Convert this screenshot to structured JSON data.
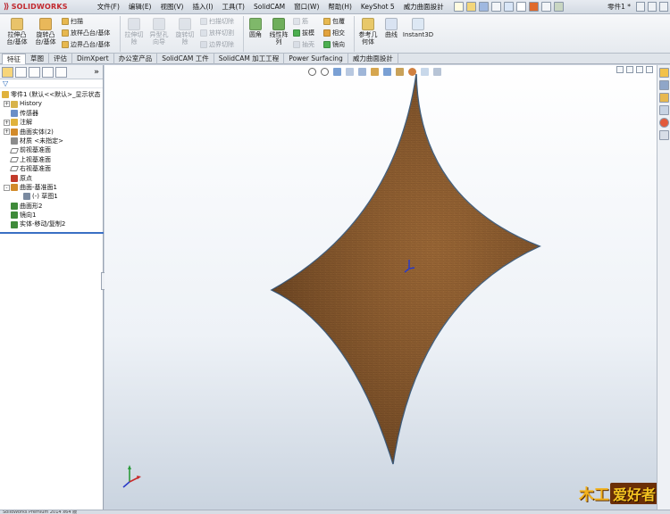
{
  "app": {
    "logo": "SOLIDWORKS",
    "doc_title": "零件1 *"
  },
  "menu": [
    "文件(F)",
    "编辑(E)",
    "视图(V)",
    "插入(I)",
    "工具(T)",
    "SolidCAM",
    "窗口(W)",
    "帮助(H)",
    "KeyShot 5",
    "威力曲面設計"
  ],
  "ribbon": {
    "extrude": "拉伸凸台/基体",
    "revolve": "旋转凸台/基体",
    "sweep": "扫描",
    "loft": "放样凸台/基体",
    "boundary": "边界凸台/基体",
    "extrude_cut": "拉伸切除",
    "hole_wizard": "异型孔向导",
    "revolve_cut": "旋转切除",
    "sweep_cut": "扫描切除",
    "loft_cut": "放样切割",
    "boundary_cut": "边界切除",
    "fillet": "圆角",
    "linear_pattern": "线性阵列",
    "rib": "筋",
    "draft": "拔模",
    "shell": "抽壳",
    "wrap": "包覆",
    "intersect": "相交",
    "mirror": "镜向",
    "ref_geometry": "参考几何体",
    "curves": "曲线",
    "instant3d": "Instant3D"
  },
  "tabs": [
    "特征",
    "草图",
    "评估",
    "DimXpert",
    "办公室产品",
    "SolidCAM 工件",
    "SolidCAM 加工工程",
    "Power Surfacing",
    "威力曲面設計"
  ],
  "tree": {
    "root": "零件1 (默认<<默认>_显示状态",
    "items": [
      {
        "label": "History",
        "pm": "+",
        "color": "#d8b34a"
      },
      {
        "label": "传感器",
        "pm": "",
        "color": "#6b8fc7"
      },
      {
        "label": "注解",
        "pm": "+",
        "color": "#e0b23c"
      },
      {
        "label": "曲面实体(2)",
        "pm": "+",
        "color": "#d28a2a"
      },
      {
        "label": "材质 <未指定>",
        "pm": "",
        "color": "#8c8c8c"
      },
      {
        "label": "前视基准面",
        "pm": "",
        "color": "plane"
      },
      {
        "label": "上视基准面",
        "pm": "",
        "color": "plane"
      },
      {
        "label": "右视基准面",
        "pm": "",
        "color": "plane"
      },
      {
        "label": "原点",
        "pm": "",
        "color": "#c23a2a"
      },
      {
        "label": "曲面-基准面1",
        "pm": "-",
        "color": "#d28a2a"
      },
      {
        "label": "(-) 草图1",
        "pm": "",
        "color": "#7a8aa0",
        "indent": 1
      },
      {
        "label": "曲面形2",
        "pm": "",
        "color": "#3f8a3a"
      },
      {
        "label": "镜向1",
        "pm": "",
        "color": "#3f8a3a"
      },
      {
        "label": "实体-移动/复制2",
        "pm": "",
        "color": "#3f8a3a"
      }
    ]
  },
  "status": "SolidWorks Premium 2014 x64 版",
  "watermark": {
    "a": "木工",
    "b": "爱好者"
  },
  "colors": {
    "accent": "#3a6fc4",
    "surface_fill": "#8a5a2c",
    "surface_edge": "#3a5f85"
  }
}
